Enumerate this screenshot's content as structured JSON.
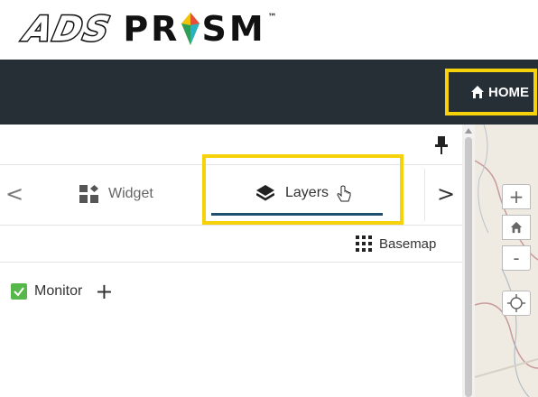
{
  "logo": {
    "brand": "ADS",
    "product_left": "PR",
    "product_right": "SM",
    "tm": "™"
  },
  "navbar": {
    "home_label": "HOME",
    "home_icon": "home-icon"
  },
  "panel": {
    "pin_icon": "pin-icon",
    "tabs": {
      "prev": "<",
      "next": ">",
      "widget_label": "Widget",
      "layers_label": "Layers"
    },
    "basemap_label": "Basemap",
    "layers": [
      {
        "label": "Monitor",
        "checked": true,
        "add": "+"
      }
    ]
  },
  "map_controls": {
    "zoom_in": "+",
    "zoom_out": "-"
  },
  "colors": {
    "highlight": "#f6d20a",
    "navbar": "#262e36",
    "tab_underline": "#1f4f6e",
    "checkbox": "#56b84a"
  }
}
